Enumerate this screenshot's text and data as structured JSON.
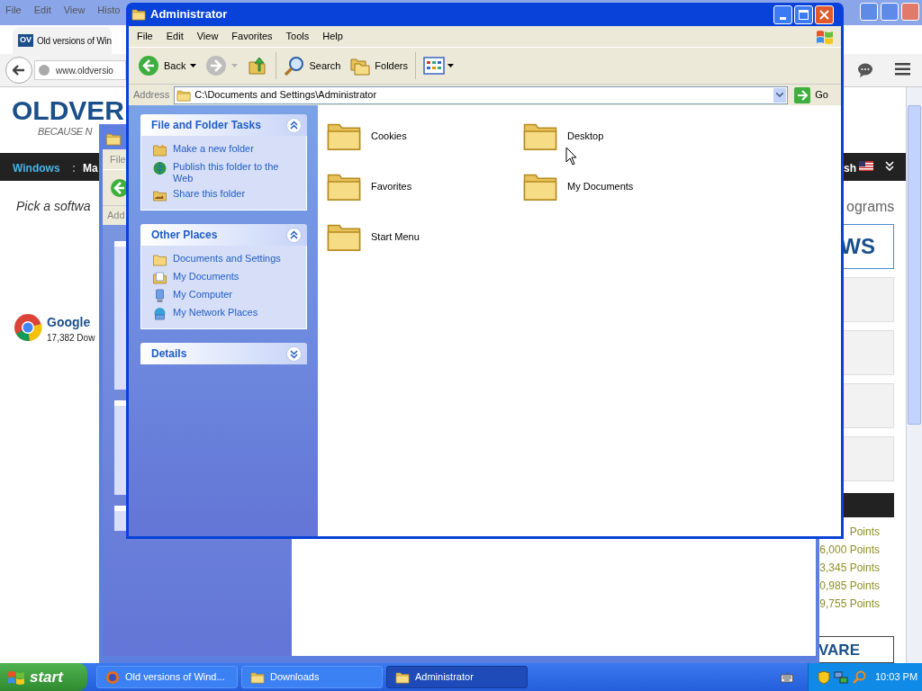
{
  "browser": {
    "menu": [
      "File",
      "Edit",
      "View",
      "Histo"
    ],
    "tab": {
      "badge": "OV",
      "title": "Old versions of Win"
    },
    "url": "www.oldversio",
    "logo": "OLDVER",
    "tagline": "BECAUSE N",
    "nav": [
      {
        "label": "Windows",
        "selected": true
      },
      {
        "label": "Ma",
        "selected": false
      }
    ],
    "nav_separator": ":",
    "nav_right": "sh",
    "heading": "Pick a softwa",
    "heading_right": "ograms",
    "banner": "WS",
    "app": {
      "name": "Google",
      "downloads": "17,382 Dow"
    },
    "points": [
      "Points",
      "6,000 Points",
      "3,345 Points",
      "0,985 Points",
      "9,755 Points"
    ],
    "footer_banner": "VARE"
  },
  "downloads_window": {
    "menu_first": "File",
    "address_label": "Add"
  },
  "explorer": {
    "title": "Administrator",
    "menu": [
      "File",
      "Edit",
      "View",
      "Favorites",
      "Tools",
      "Help"
    ],
    "toolbar": [
      {
        "kind": "back",
        "label": "Back",
        "disabled": false
      },
      {
        "kind": "forward",
        "disabled": true
      },
      {
        "kind": "up"
      },
      {
        "kind": "search",
        "label": "Search"
      },
      {
        "kind": "folders",
        "label": "Folders"
      },
      {
        "kind": "views"
      }
    ],
    "address_label": "Address",
    "address": "C:\\Documents and Settings\\Administrator",
    "go": "Go",
    "panels": [
      {
        "title": "File and Folder Tasks",
        "expanded": true,
        "items": [
          {
            "kind": "newfolder",
            "label": "Make a new folder"
          },
          {
            "kind": "publish",
            "label": "Publish this folder to the Web"
          },
          {
            "kind": "share",
            "label": "Share this folder"
          }
        ]
      },
      {
        "title": "Other Places",
        "expanded": true,
        "items": [
          {
            "kind": "folder",
            "label": "Documents and Settings"
          },
          {
            "kind": "documents",
            "label": "My Documents"
          },
          {
            "kind": "computer",
            "label": "My Computer"
          },
          {
            "kind": "network",
            "label": "My Network Places"
          }
        ]
      },
      {
        "title": "Details",
        "expanded": false
      }
    ],
    "files": [
      {
        "name": "Cookies"
      },
      {
        "name": "Desktop"
      },
      {
        "name": "Favorites"
      },
      {
        "name": "My Documents"
      },
      {
        "name": "Start Menu"
      }
    ]
  },
  "taskbar": {
    "start": "start",
    "tasks": [
      {
        "kind": "browser",
        "label": "Old versions of Wind...",
        "selected": false
      },
      {
        "kind": "folder",
        "label": "Downloads",
        "selected": false
      },
      {
        "kind": "folder",
        "label": "Administrator",
        "selected": true
      }
    ],
    "clock": "10:03 PM"
  }
}
